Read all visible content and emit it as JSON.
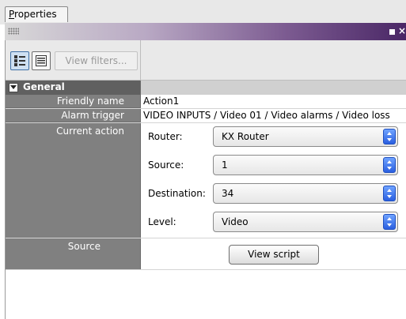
{
  "tab": {
    "label_first": "P",
    "label_rest": "roperties"
  },
  "toolbar": {
    "view_filters": "View filters..."
  },
  "group": {
    "label": "General"
  },
  "properties": {
    "friendly_name": {
      "label": "Friendly name",
      "value": "Action1"
    },
    "alarm_trigger": {
      "label": "Alarm trigger",
      "value": "VIDEO INPUTS / Video 01 / Video alarms / Video loss"
    },
    "current_action": {
      "label": "Current action",
      "router": {
        "label": "Router:",
        "value": "KX Router"
      },
      "source": {
        "label": "Source:",
        "value": "1"
      },
      "destination": {
        "label": "Destination:",
        "value": "34"
      },
      "level": {
        "label": "Level:",
        "value": "Video"
      }
    },
    "source": {
      "label": "Source",
      "button": "View script"
    }
  },
  "colors": {
    "label_column": "#808080",
    "group_header": "#606060",
    "title_bar_end": "#4a2766",
    "combo_arrow": "#2a5fe0"
  },
  "icons": {
    "categorized": "categorized-view-icon",
    "list": "list-view-icon",
    "grip": "grip-icon",
    "close": "close-icon",
    "collapse": "collapse-triangle-icon",
    "dropdown": "dropdown-arrow-icon"
  }
}
